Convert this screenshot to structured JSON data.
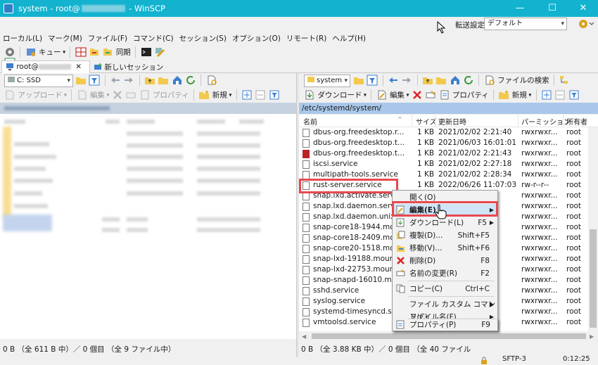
{
  "window": {
    "title_prefix": "system - root@",
    "title_suffix": " - WinSCP",
    "controls": [
      "—",
      "☐",
      "✕"
    ]
  },
  "menu": [
    "ローカル(L)",
    "マーク(M)",
    "ファイル(F)",
    "コマンド(C)",
    "セッション(S)",
    "オプション(O)",
    "リモート(R)",
    "ヘルプ(H)"
  ],
  "transfer": {
    "label": "転送設定",
    "value": "デフォルト"
  },
  "toolbar": {
    "queue": "キュー",
    "sync": "同期"
  },
  "tabs": {
    "session": "root@",
    "new_session": "新しいセッション"
  },
  "left": {
    "drive": "C: SSD",
    "upload": "アップロード",
    "edit": "編集",
    "props": "プロパティ",
    "new": "新規",
    "status": "0 B （全 611 B 中）／ 0 個目 （全 9 ファイル中）"
  },
  "right": {
    "dir": "system",
    "find": "ファイルの検索",
    "download": "ダウンロード",
    "edit": "編集",
    "props": "プロパティ",
    "new": "新規",
    "path": "/etc/systemd/system/",
    "columns": {
      "name": "名前",
      "size": "サイズ",
      "modified": "更新日時",
      "perms": "パーミッション",
      "owner": "所有者"
    },
    "files": [
      {
        "name": "dbus-org.freedesktop.r...",
        "size": "1 KB",
        "date": "2021/02/02 2:21:40",
        "perm": "rwxrwxr...",
        "owner": "root"
      },
      {
        "name": "dbus-org.freedesktop.t...",
        "size": "1 KB",
        "date": "2021/06/03 16:01:01",
        "perm": "rwxrwxr...",
        "owner": "root"
      },
      {
        "name": "dbus-org.freedesktop.t...",
        "size": "1 KB",
        "date": "2021/02/02 2:21:43",
        "perm": "rwxrwxr...",
        "owner": "root"
      },
      {
        "name": "iscsi.service",
        "size": "1 KB",
        "date": "2021/02/02 2:27:18",
        "perm": "rwxrwxr...",
        "owner": "root"
      },
      {
        "name": "multipath-tools.service",
        "size": "1 KB",
        "date": "2021/02/02 2:28:34",
        "perm": "rwxrwxr...",
        "owner": "root"
      },
      {
        "name": "rust-server.service",
        "size": "1 KB",
        "date": "2022/06/26 11:07:03",
        "perm": "rw-r--r--",
        "owner": "root"
      },
      {
        "name": "snap.lxd.activate.service",
        "size": "",
        "date": "",
        "perm": "rwxrwxr...",
        "owner": "root"
      },
      {
        "name": "snap.lxd.daemon.service",
        "size": "",
        "date": "",
        "perm": "rwxrwxr...",
        "owner": "root"
      },
      {
        "name": "snap.lxd.daemon.unix....",
        "size": "",
        "date": "",
        "perm": "rwxrwxr...",
        "owner": "root"
      },
      {
        "name": "snap-core18-1944.mount",
        "size": "",
        "date": "…8",
        "perm": "rwxrwxr...",
        "owner": "root"
      },
      {
        "name": "snap-core18-2409.mount",
        "size": "",
        "date": "…07",
        "perm": "rwxrwxr...",
        "owner": "root"
      },
      {
        "name": "snap-core20-1518.mount",
        "size": "",
        "date": "…07",
        "perm": "rwxrwxr...",
        "owner": "root"
      },
      {
        "name": "snap-lxd-19188.mount",
        "size": "",
        "date": "…38",
        "perm": "rwxrwxr...",
        "owner": "root"
      },
      {
        "name": "snap-lxd-22753.mount",
        "size": "",
        "date": "…37",
        "perm": "rwxrwxr...",
        "owner": "root"
      },
      {
        "name": "snap-snapd-16010.mo...",
        "size": "",
        "date": "…35",
        "perm": "rwxrwxr...",
        "owner": "root"
      },
      {
        "name": "sshd.service",
        "size": "",
        "date": "…20",
        "perm": "rwxrwxr...",
        "owner": "root"
      },
      {
        "name": "syslog.service",
        "size": "",
        "date": "…45",
        "perm": "rwxrwxr...",
        "owner": "root"
      },
      {
        "name": "systemd-timesyncd.se...",
        "size": "",
        "date": "…21",
        "perm": "rwxrwxr...",
        "owner": "root"
      },
      {
        "name": "vmtoolsd.service",
        "size": "",
        "date": "…20",
        "perm": "rwxrwxr...",
        "owner": "root"
      }
    ],
    "status": "0 B （全 3.88 KB 中）／ 0 個目 （全 40 ファイル中）"
  },
  "context_menu": [
    {
      "label": "開く(O)",
      "shortcut": ""
    },
    {
      "label": "編集(E)",
      "shortcut": "",
      "highlight": true,
      "submenu": true
    },
    {
      "label": "ダウンロード(L)",
      "shortcut": "F5",
      "submenu": true
    },
    {
      "label": "複製(D)...",
      "shortcut": "Shift+F5"
    },
    {
      "label": "移動(V)...",
      "shortcut": "Shift+F6"
    },
    {
      "label": "削除(D)",
      "shortcut": "F8"
    },
    {
      "label": "名前の変更(R)",
      "shortcut": "F2"
    },
    {
      "label": "コピー(C)",
      "shortcut": "Ctrl+C"
    },
    {
      "label": "ファイル カスタム コマンド(C)",
      "shortcut": "",
      "submenu": true
    },
    {
      "label": "ファイル名(F)",
      "shortcut": "",
      "submenu": true
    },
    {
      "label": "プロパティ(P)",
      "shortcut": "F9"
    }
  ],
  "statusbar": {
    "protocol": "SFTP-3",
    "time": "0:12:25"
  }
}
